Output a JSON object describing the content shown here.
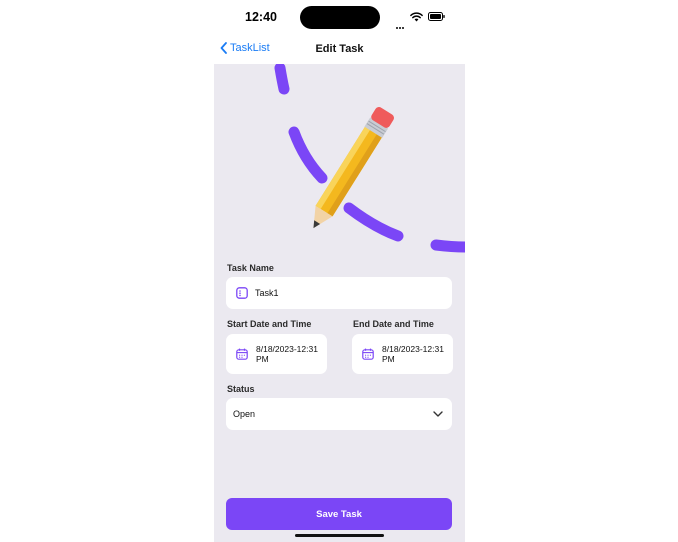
{
  "status_bar": {
    "time": "12:40"
  },
  "nav": {
    "back_label": "TaskList",
    "title": "Edit Task"
  },
  "form": {
    "task_name": {
      "label": "Task Name",
      "value": "Task1"
    },
    "start_date": {
      "label": "Start Date and Time",
      "value_line1": "8/18/2023-12:31",
      "value_line2": "PM"
    },
    "end_date": {
      "label": "End Date and Time",
      "value_line1": "8/18/2023-12:31",
      "value_line2": "PM"
    },
    "status": {
      "label": "Status",
      "value": "Open"
    }
  },
  "actions": {
    "save_label": "Save Task"
  },
  "colors": {
    "accent": "#7b46f6",
    "link": "#1a7cf5",
    "background": "#ebe9f0"
  },
  "icons": [
    "chevron-left-icon",
    "wifi-icon",
    "battery-icon",
    "pencil-icon",
    "task-icon",
    "calendar-icon",
    "chevron-down-icon"
  ]
}
